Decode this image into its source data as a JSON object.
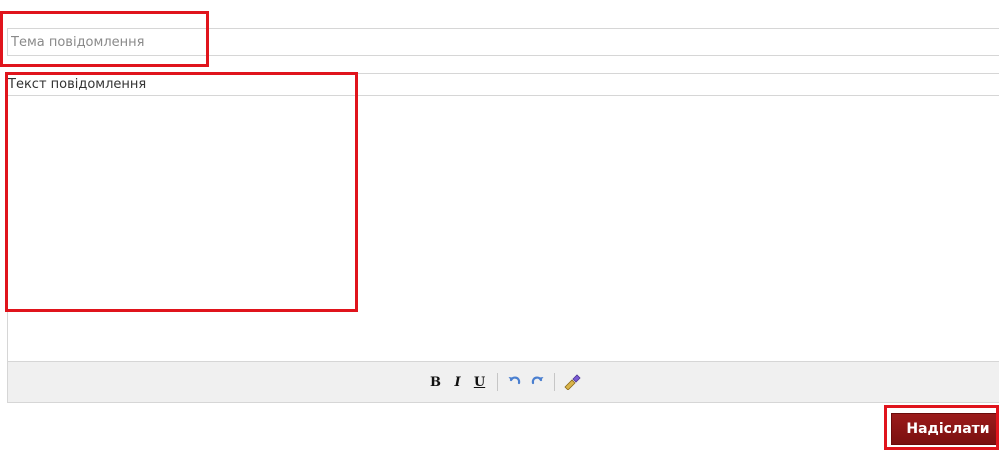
{
  "form": {
    "subject": {
      "placeholder": "Тема повідомлення",
      "value": ""
    },
    "message": {
      "label": "Текст повідомлення",
      "value": ""
    },
    "toolbar": {
      "bold_label": "B",
      "italic_label": "I",
      "underline_label": "U",
      "undo_icon": "undo-icon",
      "redo_icon": "redo-icon",
      "clear_icon": "clear-format-icon"
    },
    "send_label": "Надіслати"
  },
  "colors": {
    "highlight": "#e0141c",
    "send_button": "#8b1414",
    "toolbar_bg": "#f0f0f0",
    "border": "#d6d6d6"
  }
}
